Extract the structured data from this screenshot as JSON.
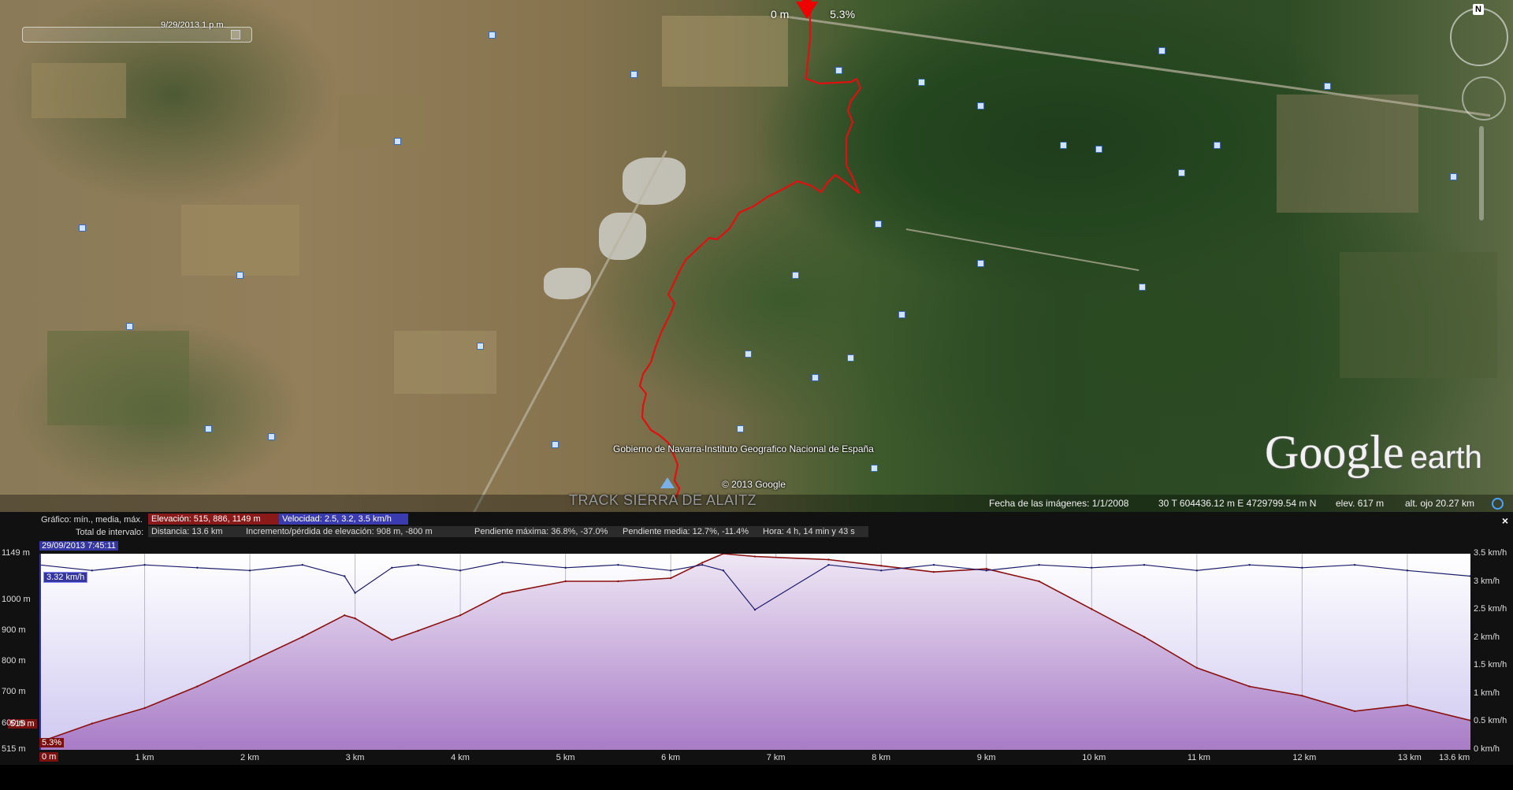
{
  "map": {
    "time_label": "9/29/2013   1 p.m.",
    "marker_distance": "0 m",
    "marker_slope": "5.3%",
    "compass_letter": "N",
    "attribution": "Gobierno de Navarra-Instituto Geografico Nacional de España",
    "copyright": "© 2013 Google",
    "track_title": "TRACK SIERRA DE ALAITZ",
    "logo_google": "Google",
    "logo_earth": "earth",
    "track_color": "#e01010"
  },
  "statusbar": {
    "imagery_date": "Fecha de las imágenes: 1/1/2008",
    "coords": "30 T 604436.12 m E 4729799.54 m N",
    "elevation": "elev.   617 m",
    "eye_alt": "alt. ojo   20.27 km"
  },
  "profile": {
    "header": {
      "chart_label": "Gráfico: mín., media, máx.",
      "elevation_chip": "Elevación: 515, 886, 1149 m",
      "speed_chip": "Velocidad: 2.5, 3.2, 3.5 km/h",
      "interval_label": "Total de intervalo:",
      "distance": "Distancia: 13.6 km",
      "gain_loss": "Incremento/pérdida de elevación: 908 m, -800 m",
      "max_slope": "Pendiente máxima: 36.8%, -37.0%",
      "avg_slope": "Pendiente media: 12.7%, -11.4%",
      "time": "Hora: 4 h, 14 min y 43 s",
      "close": "×"
    },
    "cursor": {
      "timestamp": "29/09/2013 7:45:11",
      "speed": "3.32 km/h",
      "elevation": "515 m",
      "slope": "5.3%",
      "distance": "0 m"
    },
    "y_left_labels": [
      "1149 m",
      "1000 m",
      "900 m",
      "800 m",
      "700 m",
      "600 m",
      "515 m"
    ],
    "y_right_labels": [
      "3.5 km/h",
      "3 km/h",
      "2.5 km/h",
      "2 km/h",
      "1.5 km/h",
      "1 km/h",
      "0.5 km/h",
      "0 km/h"
    ],
    "x_labels": [
      "1 km",
      "2 km",
      "3 km",
      "4 km",
      "5 km",
      "6 km",
      "7 km",
      "8 km",
      "9 km",
      "10 km",
      "11 km",
      "12 km",
      "13 km",
      "13.6 km"
    ],
    "colors": {
      "elevation_line": "#8b1010",
      "speed_line": "#1a1a6a",
      "fill_top": "#efe8f5",
      "fill_bottom": "#a87bc6",
      "bg_top": "#ffffff",
      "bg_bottom": "#cfc8f0"
    }
  },
  "chart_data": {
    "type": "area",
    "x_unit": "km",
    "xlim": [
      0,
      13.6
    ],
    "series": [
      {
        "name": "Elevación",
        "unit": "m",
        "ylim": [
          515,
          1149
        ],
        "x": [
          0,
          0.5,
          1.0,
          1.5,
          2.0,
          2.5,
          2.9,
          3.0,
          3.35,
          3.6,
          4.0,
          4.4,
          5.0,
          5.5,
          6.0,
          6.3,
          6.5,
          6.8,
          7.5,
          8.0,
          8.5,
          9.0,
          9.5,
          10.0,
          10.5,
          11.0,
          11.5,
          12.0,
          12.5,
          13.0,
          13.6
        ],
        "values": [
          540,
          600,
          650,
          720,
          800,
          880,
          950,
          940,
          870,
          900,
          950,
          1020,
          1060,
          1060,
          1070,
          1120,
          1149,
          1140,
          1130,
          1110,
          1090,
          1100,
          1060,
          970,
          880,
          780,
          720,
          690,
          640,
          660,
          610
        ]
      },
      {
        "name": "Velocidad",
        "unit": "km/h",
        "ylim": [
          0,
          3.5
        ],
        "x": [
          0,
          0.5,
          1.0,
          1.5,
          2.0,
          2.5,
          2.9,
          3.0,
          3.35,
          3.6,
          4.0,
          4.4,
          5.0,
          5.5,
          6.0,
          6.3,
          6.5,
          6.8,
          7.5,
          8.0,
          8.5,
          9.0,
          9.5,
          10.0,
          10.5,
          11.0,
          11.5,
          12.0,
          12.5,
          13.0,
          13.6
        ],
        "values": [
          3.3,
          3.2,
          3.3,
          3.25,
          3.2,
          3.3,
          3.1,
          2.8,
          3.25,
          3.3,
          3.2,
          3.35,
          3.25,
          3.3,
          3.2,
          3.3,
          3.2,
          2.5,
          3.3,
          3.2,
          3.3,
          3.2,
          3.3,
          3.25,
          3.3,
          3.2,
          3.3,
          3.25,
          3.3,
          3.2,
          3.1
        ]
      }
    ]
  }
}
